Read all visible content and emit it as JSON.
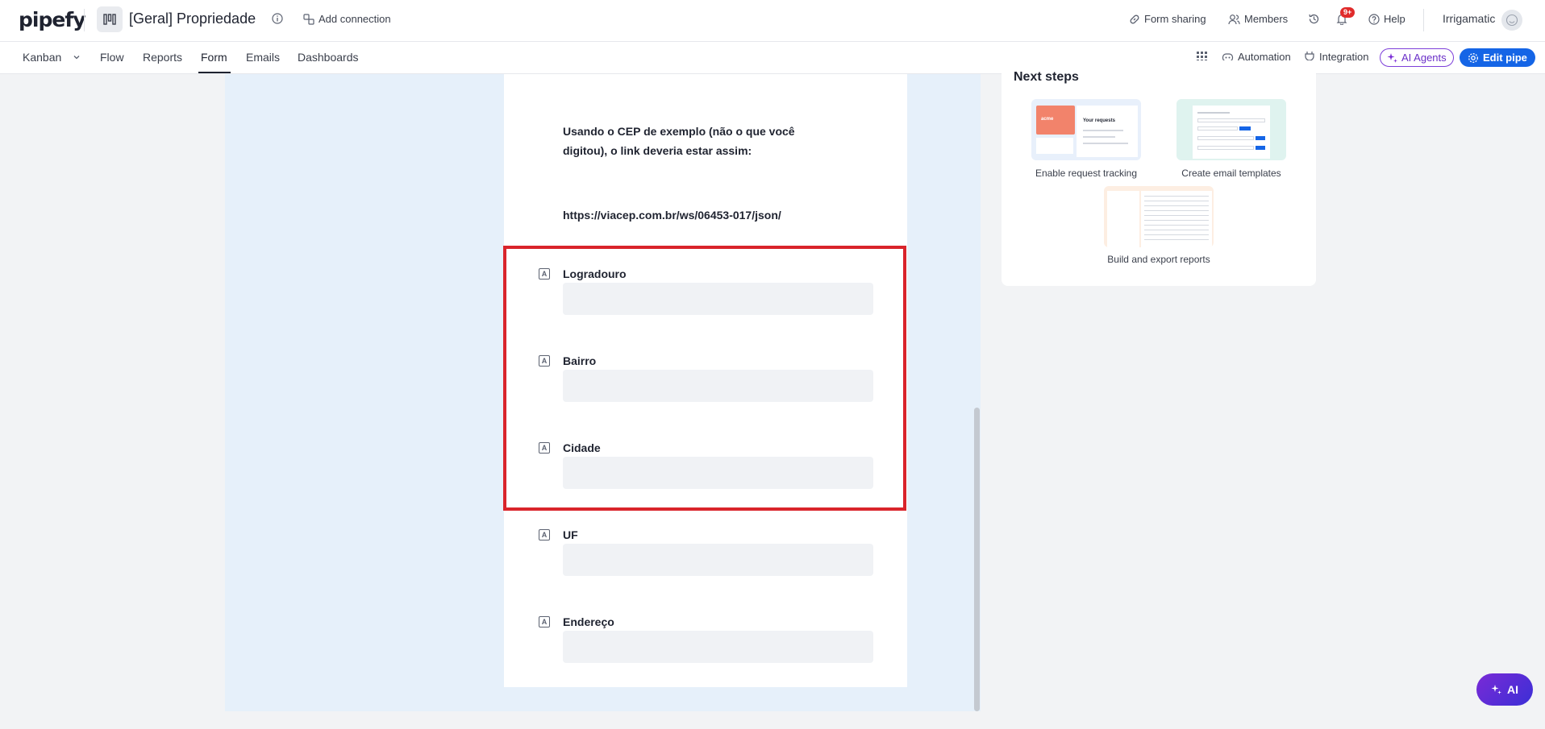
{
  "header": {
    "logo": "pipefy",
    "pipe_title": "[Geral] Propriedade",
    "add_connection": "Add connection",
    "form_sharing": "Form sharing",
    "members": "Members",
    "notifications_badge": "9+",
    "help": "Help",
    "account": "Irrigamatic"
  },
  "nav": {
    "tabs": [
      {
        "label": "Kanban"
      },
      {
        "label": "Flow"
      },
      {
        "label": "Reports"
      },
      {
        "label": "Form"
      },
      {
        "label": "Emails"
      },
      {
        "label": "Dashboards"
      }
    ],
    "active_tab": "Form",
    "automation": "Automation",
    "integration": "Integration",
    "ai_agents": "AI Agents",
    "edit_pipe": "Edit pipe"
  },
  "form": {
    "text_line1": "Usando o CEP de exemplo (não o que você",
    "text_line2": "digitou), o link deveria estar assim:",
    "example_link": "https://viacep.com.br/ws/06453-017/json/",
    "fields": [
      {
        "label": "Logradouro",
        "value": ""
      },
      {
        "label": "Bairro",
        "value": ""
      },
      {
        "label": "Cidade",
        "value": ""
      },
      {
        "label": "UF",
        "value": ""
      },
      {
        "label": "Endereço",
        "value": ""
      }
    ],
    "field_type_glyph": "A"
  },
  "side_panel": {
    "title": "Next steps",
    "items": [
      {
        "label": "Enable request tracking"
      },
      {
        "label": "Create email templates"
      },
      {
        "label": "Build and export reports"
      }
    ],
    "thumb_text": {
      "acme": "acme",
      "your_requests": "Your requests"
    }
  },
  "ai_button": "AI",
  "colors": {
    "primary": "#1565e6",
    "ai_purple": "#7a2ad6",
    "highlight": "#d9242b",
    "canvas": "#e6f0fa"
  }
}
